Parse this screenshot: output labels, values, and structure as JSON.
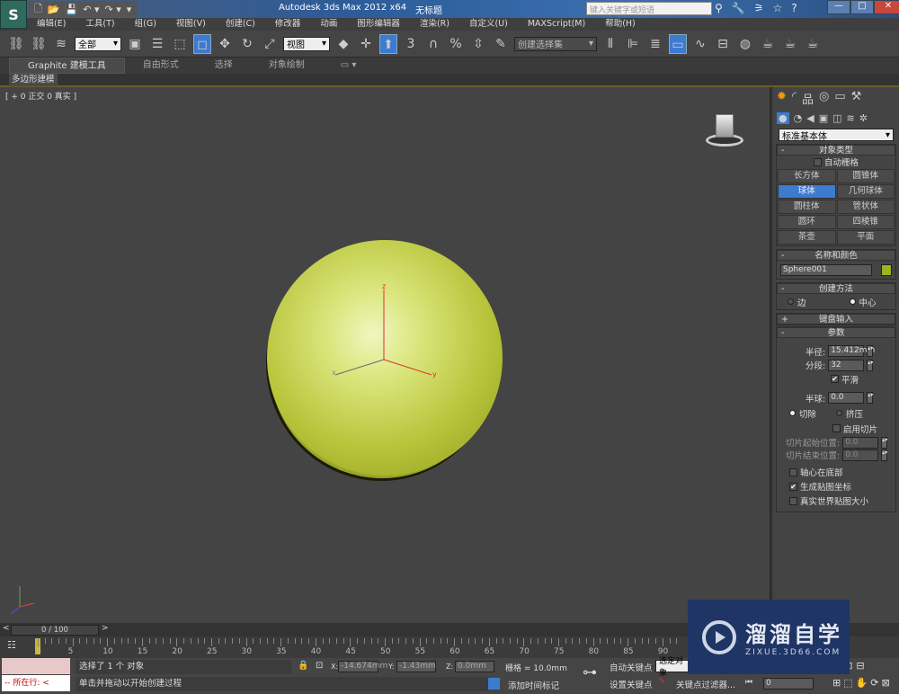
{
  "window": {
    "title": "Autodesk 3ds Max  2012 x64",
    "file": "无标题",
    "search_placeholder": "键入关键字或短语",
    "logo": "S",
    "min": "—",
    "max": "□",
    "close": "✕"
  },
  "quick_access": [
    "🗋",
    "📂",
    "💾",
    "↶ ▾",
    "↷ ▾",
    "▾"
  ],
  "help_icons": [
    "binoculars-icon",
    "wrench-icon",
    "satellite-icon",
    "star-icon",
    "help-icon"
  ],
  "menu": [
    "编辑(E)",
    "工具(T)",
    "组(G)",
    "视图(V)",
    "创建(C)",
    "修改器",
    "动画",
    "图形编辑器",
    "渲染(R)",
    "自定义(U)",
    "MAXScript(M)",
    "帮助(H)"
  ],
  "toolbar": {
    "selection_filter": "全部",
    "reference_coord": "视图",
    "named_selection": "创建选择集",
    "snap_3": "3",
    "snap_percent": "%"
  },
  "ribbon": {
    "tabs": [
      "Graphite 建模工具",
      "自由形式",
      "选择",
      "对象绘制"
    ],
    "active_tab": 0,
    "subpanel": "多边形建模"
  },
  "viewport": {
    "label": "[ + 0 正交 0 真实 ]",
    "axes": {
      "x": "x",
      "y": "y",
      "z": "z"
    },
    "object_color": "#c8d24a"
  },
  "panel": {
    "category": "标准基本体",
    "object_type": {
      "title": "对象类型",
      "autogrid": "自动栅格",
      "buttons": [
        "长方体",
        "圆锥体",
        "球体",
        "几何球体",
        "圆柱体",
        "管状体",
        "圆环",
        "四棱锥",
        "茶壶",
        "平面"
      ],
      "selected": "球体"
    },
    "name_color": {
      "title": "名称和颜色",
      "name": "Sphere001",
      "color": "#9ab51e"
    },
    "creation_method": {
      "title": "创建方法",
      "options": [
        "边",
        "中心"
      ],
      "selected": "中心"
    },
    "keyboard_entry": {
      "title": "键盘输入"
    },
    "parameters": {
      "title": "参数",
      "radius_label": "半径:",
      "radius": "15.412mm",
      "segments_label": "分段:",
      "segments": "32",
      "smooth_label": "平滑",
      "smooth": true,
      "hemisphere_label": "半球:",
      "hemisphere": "0.0",
      "chop": "切除",
      "squash": "挤压",
      "hemi_mode": "切除",
      "slice_on_label": "启用切片",
      "slice_on": false,
      "slice_from_label": "切片起始位置:",
      "slice_from": "0.0",
      "slice_to_label": "切片结束位置:",
      "slice_to": "0.0",
      "base_to_pivot": "轴心在底部",
      "base_to_pivot_on": false,
      "gen_map": "生成贴图坐标",
      "gen_map_on": true,
      "real_world": "真实世界贴图大小",
      "real_world_on": false
    }
  },
  "timeline": {
    "frame": "0 / 100",
    "prev": "<",
    "next": ">",
    "ticks": [
      "0",
      "5",
      "10",
      "15",
      "20",
      "25",
      "30",
      "35",
      "40",
      "45",
      "50",
      "55",
      "60",
      "65",
      "70",
      "75",
      "80",
      "85",
      "90"
    ]
  },
  "status": {
    "maxscript_line": "--  所在行:  <",
    "selected": "选择了 1 个 对象",
    "prompt": "单击并拖动以开始创建过程",
    "x_label": "X:",
    "x": "-14.674mm",
    "y_label": "Y:",
    "y": "-1.43mm",
    "z_label": "Z:",
    "z": "0.0mm",
    "grid": "栅格 = 10.0mm",
    "add_time_tag": "添加时间标记",
    "auto_key": "自动关键点",
    "selected_obj": "选定对象",
    "set_key": "设置关键点",
    "key_filters": "关键点过滤器...",
    "current_frame": "0"
  },
  "watermark": {
    "brand": "溜溜自学",
    "url": "ZIXUE.3D66.COM"
  }
}
